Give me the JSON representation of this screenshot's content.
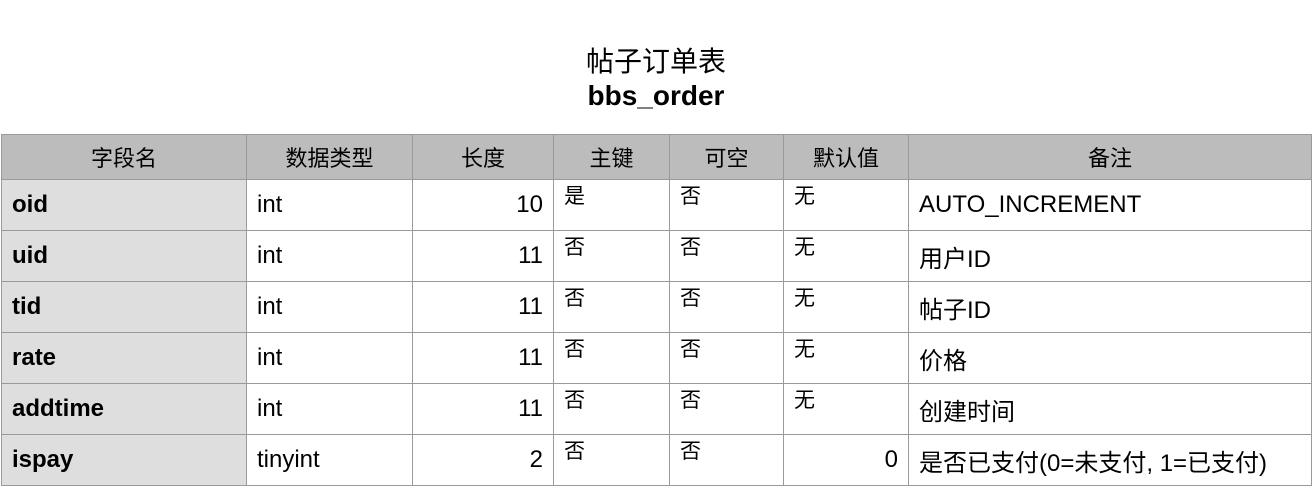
{
  "title": {
    "chinese": "帖子订单表",
    "table_name": "bbs_order"
  },
  "headers": [
    "字段名",
    "数据类型",
    "长度",
    "主键",
    "可空",
    "默认值",
    "备注"
  ],
  "rows": [
    {
      "field": "oid",
      "type": "int",
      "length": "10",
      "primary_key": "是",
      "nullable": "否",
      "default": "无",
      "note": "AUTO_INCREMENT"
    },
    {
      "field": "uid",
      "type": "int",
      "length": "11",
      "primary_key": "否",
      "nullable": "否",
      "default": "无",
      "note": "用户ID"
    },
    {
      "field": "tid",
      "type": "int",
      "length": "11",
      "primary_key": "否",
      "nullable": "否",
      "default": "无",
      "note": "帖子ID"
    },
    {
      "field": "rate",
      "type": "int",
      "length": "11",
      "primary_key": "否",
      "nullable": "否",
      "default": "无",
      "note": "价格"
    },
    {
      "field": "addtime",
      "type": "int",
      "length": "11",
      "primary_key": "否",
      "nullable": "否",
      "default": "无",
      "note": "创建时间"
    },
    {
      "field": "ispay",
      "type": "tinyint",
      "length": "2",
      "primary_key": "否",
      "nullable": "否",
      "default": "0",
      "note": "是否已支付(0=未支付, 1=已支付)"
    }
  ],
  "colors": {
    "header_bg": "#bcbcbc",
    "field_column_bg": "#dedede",
    "border": "#9a9a9a"
  }
}
